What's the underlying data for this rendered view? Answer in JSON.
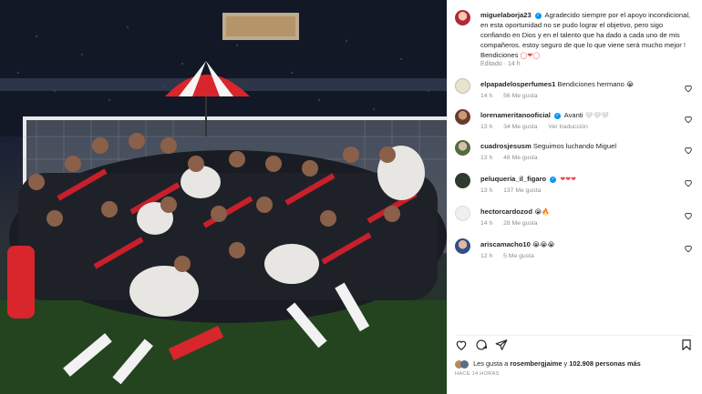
{
  "post": {
    "author": "miguelaborja23",
    "caption": "Agradecido siempre por el apoyo incondicional, en esta oportunidad no se pudo lograr el objetivo, pero sigo confiando en Dios y en el talento que ha dado a cada uno de mis compañeros. estoy seguro de que lo que viene será mucho mejor ! Bendiciones",
    "caption_emojis": "◯❤◯",
    "edited_label": "Editado",
    "edited_time": "14 h",
    "likes_prefix": "Les gusta a",
    "likes_user": "rosembergjaime",
    "likes_joiner": "y",
    "likes_count": "102.908 personas más",
    "posted_ago": "HACE 14 HORAS"
  },
  "comments": [
    {
      "user": "elpapadelosperfumes1",
      "verified": false,
      "text": "Bendiciones hermano",
      "emoji": "😭",
      "time": "14 h",
      "likes": "56 Me gusta",
      "extra": ""
    },
    {
      "user": "lorenameritanooficial",
      "verified": true,
      "text": "Avanti",
      "emoji": "🤍🤍🤍",
      "time": "13 h",
      "likes": "34 Me gusta",
      "extra": "Ver traducción"
    },
    {
      "user": "cuadrosjesusm",
      "verified": false,
      "text": "Seguimos luchando Miguel",
      "emoji": "",
      "time": "13 h",
      "likes": "48 Me gusta",
      "extra": ""
    },
    {
      "user": "peluqueria_il_figaro",
      "verified": true,
      "text": "",
      "emoji": "❤❤❤",
      "time": "13 h",
      "likes": "137 Me gusta",
      "extra": ""
    },
    {
      "user": "hectorcardozod",
      "verified": false,
      "text": "",
      "emoji": "😭🔥",
      "time": "14 h",
      "likes": "28 Me gusta",
      "extra": ""
    },
    {
      "user": "ariscamacho10",
      "verified": false,
      "text": "",
      "emoji": "😭😭😭",
      "time": "12 h",
      "likes": "5 Me gusta",
      "extra": ""
    }
  ],
  "icons": {
    "like": "heart-icon",
    "comment": "comment-icon",
    "share": "send-icon",
    "save": "bookmark-icon"
  },
  "colors": {
    "verified": "#0095f6",
    "red": "#ed4956",
    "muted": "#8e8e8e"
  }
}
